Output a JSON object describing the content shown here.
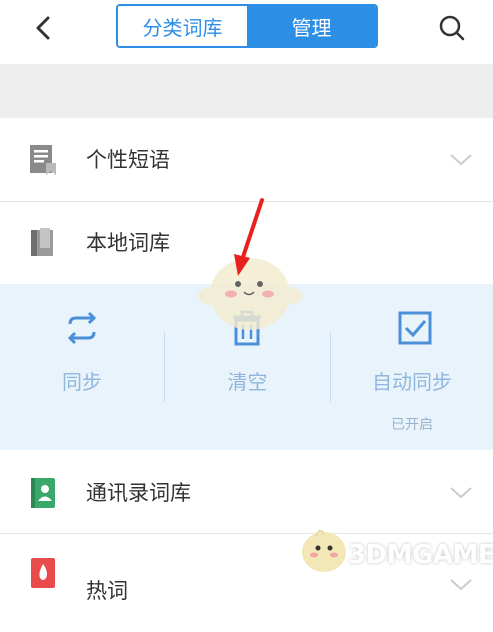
{
  "header": {
    "back_icon": "chevron-left-icon",
    "tabs": [
      {
        "label": "分类词库",
        "active": false
      },
      {
        "label": "管理",
        "active": true
      }
    ],
    "search_icon": "search-icon"
  },
  "rows": [
    {
      "label": "个性短语",
      "icon": "document-icon",
      "expandable": true
    },
    {
      "label": "本地词库",
      "icon": "book-icon",
      "expandable": false
    },
    {
      "label": "通讯录词库",
      "icon": "contacts-book-icon",
      "expandable": true
    },
    {
      "label": "热词",
      "icon": "fire-icon",
      "expandable": true
    }
  ],
  "local_actions": [
    {
      "label": "同步",
      "icon": "sync-icon"
    },
    {
      "label": "清空",
      "icon": "trash-icon"
    },
    {
      "label": "自动同步",
      "icon": "checkbox-icon",
      "status": "已开启"
    }
  ],
  "watermark": {
    "text": "3DMGAME"
  },
  "colors": {
    "accent": "#2d8ee6",
    "action_panel_bg": "#e9f3fc",
    "action_text": "#8fb7dd",
    "divider": "#e6e6e6",
    "separator_band": "#eeeeee",
    "annotation_arrow": "#e8211e"
  }
}
